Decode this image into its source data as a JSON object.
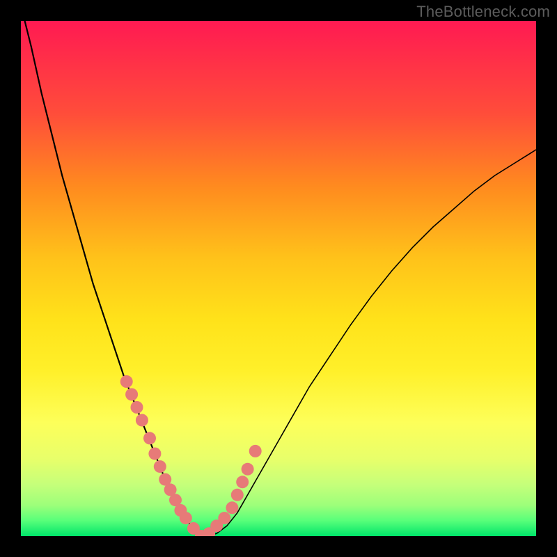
{
  "watermark": "TheBottleneck.com",
  "colors": {
    "curve": "#000000",
    "dot": "#e77a78",
    "gradient_top": "#ff1a52",
    "gradient_bottom": "#00e56a"
  },
  "chart_data": {
    "type": "line",
    "title": "",
    "xlabel": "",
    "ylabel": "",
    "xlim": [
      0,
      100
    ],
    "ylim": [
      0,
      100
    ],
    "x": [
      0,
      2,
      4,
      6,
      8,
      10,
      12,
      14,
      16,
      18,
      20,
      22,
      24,
      26,
      27,
      28,
      29,
      30,
      31,
      32,
      33,
      34,
      35,
      36,
      38,
      40,
      42,
      44,
      46,
      48,
      50,
      52,
      54,
      56,
      60,
      64,
      68,
      72,
      76,
      80,
      84,
      88,
      92,
      96,
      100
    ],
    "series": [
      {
        "name": "bottleneck-curve",
        "values": [
          103,
          95,
          86,
          78,
          70,
          63,
          56,
          49,
          43,
          37,
          31,
          26,
          21,
          16,
          13.5,
          11,
          9,
          7,
          5,
          3.5,
          2,
          1,
          0.5,
          0,
          0.5,
          2,
          4.5,
          8,
          11.5,
          15,
          18.5,
          22,
          25.5,
          29,
          35,
          41,
          46.5,
          51.5,
          56,
          60,
          63.5,
          67,
          70,
          72.5,
          75
        ]
      }
    ],
    "dot_highlights_x": [
      20.5,
      21.5,
      22.5,
      23.5,
      25,
      26,
      27,
      28,
      29,
      30,
      31,
      32,
      33.5,
      35,
      36.5,
      38,
      39.5,
      41,
      42,
      43,
      44,
      45.5
    ],
    "dot_highlights_y": [
      30,
      27.5,
      25,
      22.5,
      19,
      16,
      13.5,
      11,
      9,
      7,
      5,
      3.5,
      1.5,
      0,
      0.5,
      2,
      3.5,
      5.5,
      8,
      10.5,
      13,
      16.5
    ]
  }
}
